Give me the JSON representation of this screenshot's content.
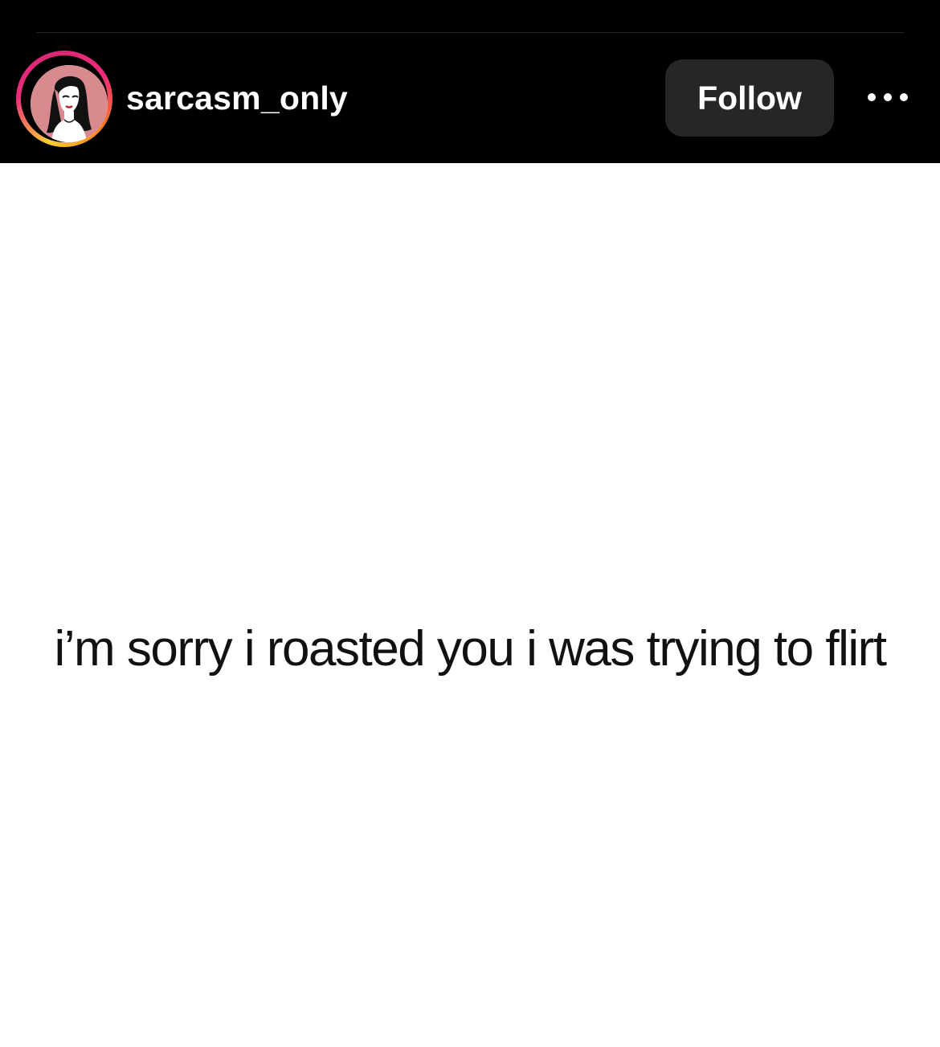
{
  "header": {
    "username": "sarcasm_only",
    "follow_label": "Follow",
    "more_icon": "more-horizontal-icon",
    "avatar_icon": "profile-avatar"
  },
  "post": {
    "caption_text": "i’m sorry i roasted you i was trying to flirt"
  },
  "colors": {
    "background": "#000000",
    "post_background": "#ffffff",
    "follow_button": "#262626",
    "story_ring_start": "#f9ce34",
    "story_ring_mid": "#ee2a7b",
    "avatar_bg": "#d98a8f"
  }
}
